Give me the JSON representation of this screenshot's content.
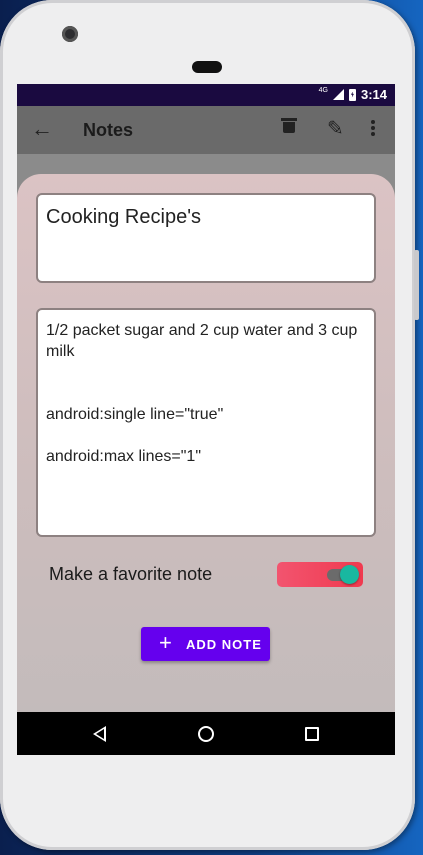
{
  "status_bar": {
    "network": "4G",
    "time": "3:14"
  },
  "app_bar": {
    "title": "Notes"
  },
  "note": {
    "title": "Cooking Recipe's",
    "body": "1/2 packet sugar and 2 cup water and 3 cup milk\n\n\nandroid:single line=\"true\"\n\nandroid:max lines=\"1\""
  },
  "favorite": {
    "label": "Make a favorite note",
    "enabled": true
  },
  "add_button": {
    "label": "ADD NOTE",
    "icon": "plus-icon"
  },
  "colors": {
    "accent": "#6500ee",
    "status_bar": "#1a0a40",
    "switch_bg": "#f03a4f",
    "switch_knob": "#19b8a0"
  },
  "icons": [
    "back-arrow-icon",
    "trash-icon",
    "pencil-icon",
    "overflow-menu-icon",
    "nav-back-icon",
    "nav-home-icon",
    "nav-recents-icon"
  ]
}
